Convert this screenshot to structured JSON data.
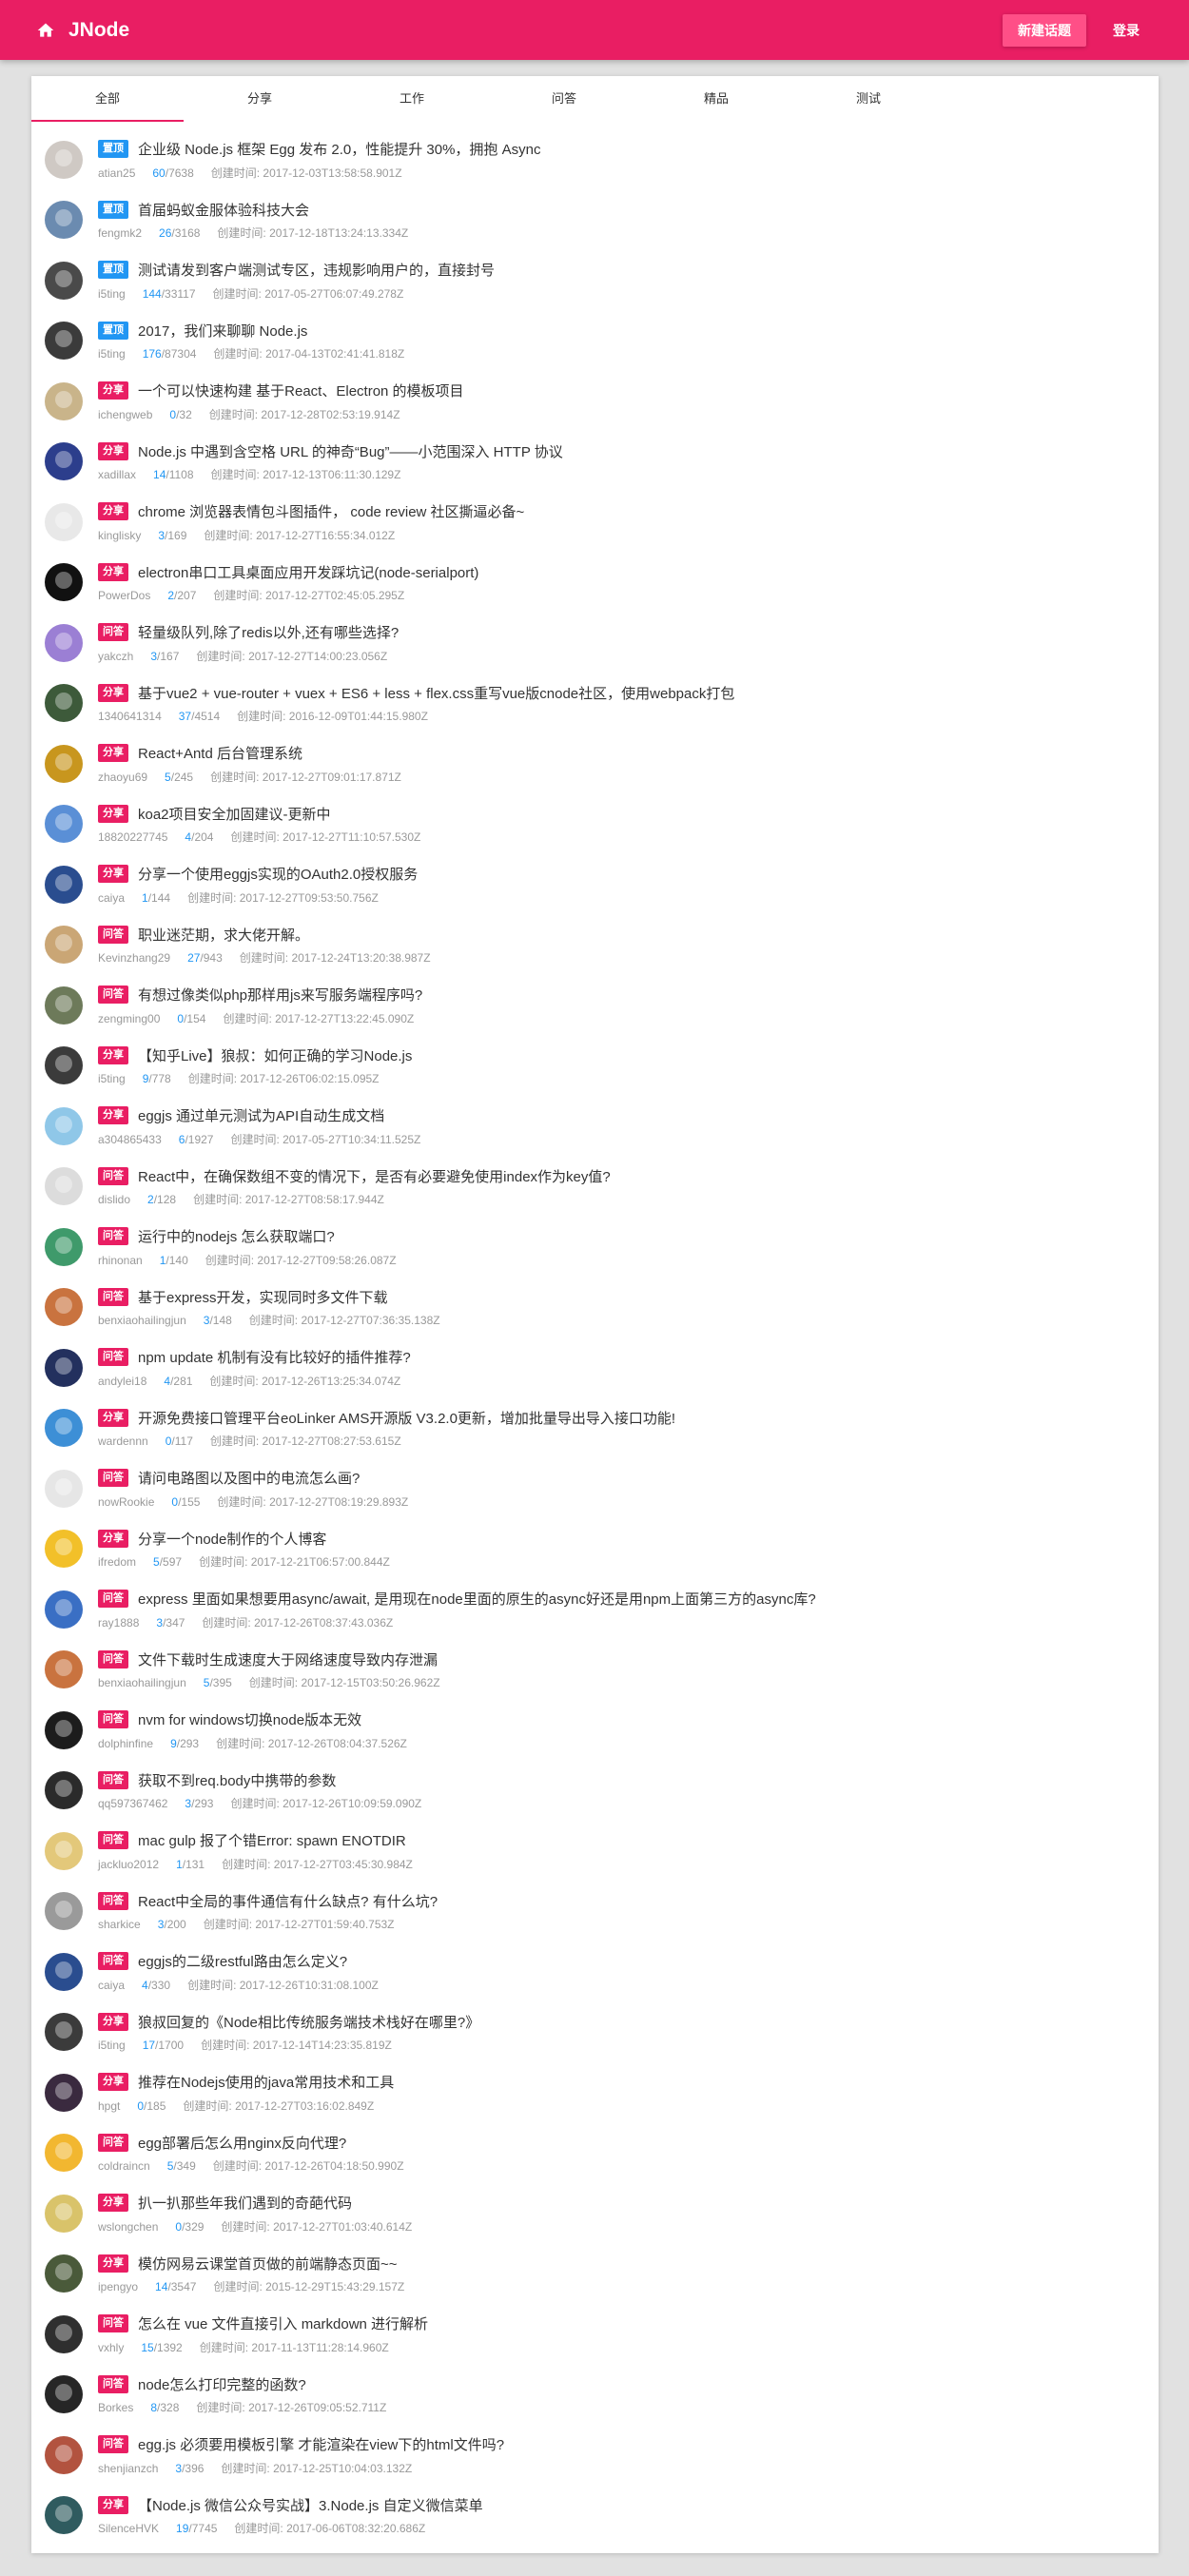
{
  "colors": {
    "primary": "#e91e63",
    "top_tag": "#2196f3",
    "other_tag": "#e91e63",
    "reply": "#2196f3"
  },
  "header": {
    "home_icon": "home-icon",
    "title": "JNode",
    "new_topic_label": "新建话题",
    "login_label": "登录"
  },
  "tabs": [
    {
      "label": "全部",
      "active": true
    },
    {
      "label": "分享",
      "active": false
    },
    {
      "label": "工作",
      "active": false
    },
    {
      "label": "问答",
      "active": false
    },
    {
      "label": "精品",
      "active": false
    },
    {
      "label": "测试",
      "active": false
    }
  ],
  "topics": [
    {
      "avatar_color": "#cfc9c4",
      "tag": "置顶",
      "tag_type": "top",
      "title": "企业级 Node.js 框架 Egg 发布 2.0，性能提升 30%，拥抱 Async",
      "author": "atian25",
      "replies": "60",
      "visits": "/7638",
      "created": "创建时间: 2017-12-03T13:58:58.901Z"
    },
    {
      "avatar_color": "#6b8bb0",
      "tag": "置顶",
      "tag_type": "top",
      "title": "首届蚂蚁金服体验科技大会",
      "author": "fengmk2",
      "replies": "26",
      "visits": "/3168",
      "created": "创建时间: 2017-12-18T13:24:13.334Z"
    },
    {
      "avatar_color": "#4a4a4a",
      "tag": "置顶",
      "tag_type": "top",
      "title": "测试请发到客户端测试专区，违规影响用户的，直接封号",
      "author": "i5ting",
      "replies": "144",
      "visits": "/33117",
      "created": "创建时间: 2017-05-27T06:07:49.278Z"
    },
    {
      "avatar_color": "#3b3b3b",
      "tag": "置顶",
      "tag_type": "top",
      "title": "2017，我们来聊聊 Node.js",
      "author": "i5ting",
      "replies": "176",
      "visits": "/87304",
      "created": "创建时间: 2017-04-13T02:41:41.818Z"
    },
    {
      "avatar_color": "#c9b48a",
      "tag": "分享",
      "tag_type": "other",
      "title": "一个可以快速构建 基于React、Electron 的模板项目",
      "author": "ichengweb",
      "replies": "0",
      "visits": "/32",
      "created": "创建时间: 2017-12-28T02:53:19.914Z"
    },
    {
      "avatar_color": "#2c3e8c",
      "tag": "分享",
      "tag_type": "other",
      "title": "Node.js 中遇到含空格 URL 的神奇“Bug”——小范围深入 HTTP 协议",
      "author": "xadillax",
      "replies": "14",
      "visits": "/1108",
      "created": "创建时间: 2017-12-13T06:11:30.129Z"
    },
    {
      "avatar_color": "#e8e8e8",
      "tag": "分享",
      "tag_type": "other",
      "title": "chrome 浏览器表情包斗图插件， code review 社区撕逼必备~",
      "author": "kinglisky",
      "replies": "3",
      "visits": "/169",
      "created": "创建时间: 2017-12-27T16:55:34.012Z"
    },
    {
      "avatar_color": "#111111",
      "tag": "分享",
      "tag_type": "other",
      "title": "electron串口工具桌面应用开发踩坑记(node-serialport)",
      "author": "PowerDos",
      "replies": "2",
      "visits": "/207",
      "created": "创建时间: 2017-12-27T02:45:05.295Z"
    },
    {
      "avatar_color": "#9b7fd4",
      "tag": "问答",
      "tag_type": "other",
      "title": "轻量级队列,除了redis以外,还有哪些选择?",
      "author": "yakczh",
      "replies": "3",
      "visits": "/167",
      "created": "创建时间: 2017-12-27T14:00:23.056Z"
    },
    {
      "avatar_color": "#3d5a3a",
      "tag": "分享",
      "tag_type": "other",
      "title": "基于vue2 + vue-router + vuex + ES6 + less + flex.css重写vue版cnode社区，使用webpack打包",
      "author": "1340641314",
      "replies": "37",
      "visits": "/4514",
      "created": "创建时间: 2016-12-09T01:44:15.980Z"
    },
    {
      "avatar_color": "#c8961e",
      "tag": "分享",
      "tag_type": "other",
      "title": "React+Antd 后台管理系统",
      "author": "zhaoyu69",
      "replies": "5",
      "visits": "/245",
      "created": "创建时间: 2017-12-27T09:01:17.871Z"
    },
    {
      "avatar_color": "#5a8fd6",
      "tag": "分享",
      "tag_type": "other",
      "title": "koa2项目安全加固建议-更新中",
      "author": "18820227745",
      "replies": "4",
      "visits": "/204",
      "created": "创建时间: 2017-12-27T11:10:57.530Z"
    },
    {
      "avatar_color": "#2a4d8f",
      "tag": "分享",
      "tag_type": "other",
      "title": "分享一个使用eggjs实现的OAuth2.0授权服务",
      "author": "caiya",
      "replies": "1",
      "visits": "/144",
      "created": "创建时间: 2017-12-27T09:53:50.756Z"
    },
    {
      "avatar_color": "#caa675",
      "tag": "问答",
      "tag_type": "other",
      "title": "职业迷茫期，求大佬开解。",
      "author": "Kevinzhang29",
      "replies": "27",
      "visits": "/943",
      "created": "创建时间: 2017-12-24T13:20:38.987Z"
    },
    {
      "avatar_color": "#6d7a5a",
      "tag": "问答",
      "tag_type": "other",
      "title": "有想过像类似php那样用js来写服务端程序吗?",
      "author": "zengming00",
      "replies": "0",
      "visits": "/154",
      "created": "创建时间: 2017-12-27T13:22:45.090Z"
    },
    {
      "avatar_color": "#3b3b3b",
      "tag": "分享",
      "tag_type": "other",
      "title": "【知乎Live】狼叔：如何正确的学习Node.js",
      "author": "i5ting",
      "replies": "9",
      "visits": "/778",
      "created": "创建时间: 2017-12-26T06:02:15.095Z"
    },
    {
      "avatar_color": "#8fc7e8",
      "tag": "分享",
      "tag_type": "other",
      "title": "eggjs 通过单元测试为API自动生成文档",
      "author": "a304865433",
      "replies": "6",
      "visits": "/1927",
      "created": "创建时间: 2017-05-27T10:34:11.525Z"
    },
    {
      "avatar_color": "#dcdcdc",
      "tag": "问答",
      "tag_type": "other",
      "title": "React中，在确保数组不变的情况下，是否有必要避免使用index作为key值?",
      "author": "dislido",
      "replies": "2",
      "visits": "/128",
      "created": "创建时间: 2017-12-27T08:58:17.944Z"
    },
    {
      "avatar_color": "#3f9a6b",
      "tag": "问答",
      "tag_type": "other",
      "title": "运行中的nodejs 怎么获取端口?",
      "author": "rhinonan",
      "replies": "1",
      "visits": "/140",
      "created": "创建时间: 2017-12-27T09:58:26.087Z"
    },
    {
      "avatar_color": "#c9733f",
      "tag": "问答",
      "tag_type": "other",
      "title": "基于express开发，实现同时多文件下载",
      "author": "benxiaohailingjun",
      "replies": "3",
      "visits": "/148",
      "created": "创建时间: 2017-12-27T07:36:35.138Z"
    },
    {
      "avatar_color": "#23305e",
      "tag": "问答",
      "tag_type": "other",
      "title": "npm update 机制有没有比较好的插件推荐?",
      "author": "andylei18",
      "replies": "4",
      "visits": "/281",
      "created": "创建时间: 2017-12-26T13:25:34.074Z"
    },
    {
      "avatar_color": "#3d8fd6",
      "tag": "分享",
      "tag_type": "other",
      "title": "开源免费接口管理平台eoLinker AMS开源版 V3.2.0更新，增加批量导出导入接口功能!",
      "author": "wardennn",
      "replies": "0",
      "visits": "/117",
      "created": "创建时间: 2017-12-27T08:27:53.615Z"
    },
    {
      "avatar_color": "#e6e6e6",
      "tag": "问答",
      "tag_type": "other",
      "title": "请问电路图以及图中的电流怎么画?",
      "author": "nowRookie",
      "replies": "0",
      "visits": "/155",
      "created": "创建时间: 2017-12-27T08:19:29.893Z"
    },
    {
      "avatar_color": "#f2c029",
      "tag": "分享",
      "tag_type": "other",
      "title": "分享一个node制作的个人博客",
      "author": "ifredom",
      "replies": "5",
      "visits": "/597",
      "created": "创建时间: 2017-12-21T06:57:00.844Z"
    },
    {
      "avatar_color": "#3a6fc4",
      "tag": "问答",
      "tag_type": "other",
      "title": "express 里面如果想要用async/await, 是用现在node里面的原生的async好还是用npm上面第三方的async库?",
      "author": "ray1888",
      "replies": "3",
      "visits": "/347",
      "created": "创建时间: 2017-12-26T08:37:43.036Z"
    },
    {
      "avatar_color": "#c9733f",
      "tag": "问答",
      "tag_type": "other",
      "title": "文件下载时生成速度大于网络速度导致内存泄漏",
      "author": "benxiaohailingjun",
      "replies": "5",
      "visits": "/395",
      "created": "创建时间: 2017-12-15T03:50:26.962Z"
    },
    {
      "avatar_color": "#1c1c1c",
      "tag": "问答",
      "tag_type": "other",
      "title": "nvm for windows切换node版本无效",
      "author": "dolphinfine",
      "replies": "9",
      "visits": "/293",
      "created": "创建时间: 2017-12-26T08:04:37.526Z"
    },
    {
      "avatar_color": "#2b2b2b",
      "tag": "问答",
      "tag_type": "other",
      "title": "获取不到req.body中携带的参数",
      "author": "qq597367462",
      "replies": "3",
      "visits": "/293",
      "created": "创建时间: 2017-12-26T10:09:59.090Z"
    },
    {
      "avatar_color": "#e3c87a",
      "tag": "问答",
      "tag_type": "other",
      "title": "mac gulp 报了个错Error: spawn ENOTDIR",
      "author": "jackluo2012",
      "replies": "1",
      "visits": "/131",
      "created": "创建时间: 2017-12-27T03:45:30.984Z"
    },
    {
      "avatar_color": "#9a9a9a",
      "tag": "问答",
      "tag_type": "other",
      "title": "React中全局的事件通信有什么缺点? 有什么坑?",
      "author": "sharkice",
      "replies": "3",
      "visits": "/200",
      "created": "创建时间: 2017-12-27T01:59:40.753Z"
    },
    {
      "avatar_color": "#2a4d8f",
      "tag": "问答",
      "tag_type": "other",
      "title": "eggjs的二级restful路由怎么定义?",
      "author": "caiya",
      "replies": "4",
      "visits": "/330",
      "created": "创建时间: 2017-12-26T10:31:08.100Z"
    },
    {
      "avatar_color": "#3b3b3b",
      "tag": "分享",
      "tag_type": "other",
      "title": "狼叔回复的《Node相比传统服务端技术栈好在哪里?》",
      "author": "i5ting",
      "replies": "17",
      "visits": "/1700",
      "created": "创建时间: 2017-12-14T14:23:35.819Z"
    },
    {
      "avatar_color": "#3a2a3f",
      "tag": "分享",
      "tag_type": "other",
      "title": "推荐在Nodejs使用的java常用技术和工具",
      "author": "hpgt",
      "replies": "0",
      "visits": "/185",
      "created": "创建时间: 2017-12-27T03:16:02.849Z"
    },
    {
      "avatar_color": "#f2b730",
      "tag": "问答",
      "tag_type": "other",
      "title": "egg部署后怎么用nginx反向代理?",
      "author": "coldraincn",
      "replies": "5",
      "visits": "/349",
      "created": "创建时间: 2017-12-26T04:18:50.990Z"
    },
    {
      "avatar_color": "#d9c36a",
      "tag": "分享",
      "tag_type": "other",
      "title": "扒一扒那些年我们遇到的奇葩代码",
      "author": "wslongchen",
      "replies": "0",
      "visits": "/329",
      "created": "创建时间: 2017-12-27T01:03:40.614Z"
    },
    {
      "avatar_color": "#4a5a3a",
      "tag": "分享",
      "tag_type": "other",
      "title": "模仿网易云课堂首页做的前端静态页面~~",
      "author": "ipengyo",
      "replies": "14",
      "visits": "/3547",
      "created": "创建时间: 2015-12-29T15:43:29.157Z"
    },
    {
      "avatar_color": "#2f2f2f",
      "tag": "问答",
      "tag_type": "other",
      "title": "怎么在 vue 文件直接引入 markdown 进行解析",
      "author": "vxhly",
      "replies": "15",
      "visits": "/1392",
      "created": "创建时间: 2017-11-13T11:28:14.960Z"
    },
    {
      "avatar_color": "#262626",
      "tag": "问答",
      "tag_type": "other",
      "title": "node怎么打印完整的函数?",
      "author": "Borkes",
      "replies": "8",
      "visits": "/328",
      "created": "创建时间: 2017-12-26T09:05:52.711Z"
    },
    {
      "avatar_color": "#b2533f",
      "tag": "问答",
      "tag_type": "other",
      "title": "egg.js 必须要用模板引擎 才能渲染在view下的html文件吗?",
      "author": "shenjianzch",
      "replies": "3",
      "visits": "/396",
      "created": "创建时间: 2017-12-25T10:04:03.132Z"
    },
    {
      "avatar_color": "#2f5b5f",
      "tag": "分享",
      "tag_type": "other",
      "title": "【Node.js 微信公众号实战】3.Node.js 自定义微信菜单",
      "author": "SilenceHVK",
      "replies": "19",
      "visits": "/7745",
      "created": "创建时间: 2017-06-06T08:32:20.686Z"
    }
  ]
}
